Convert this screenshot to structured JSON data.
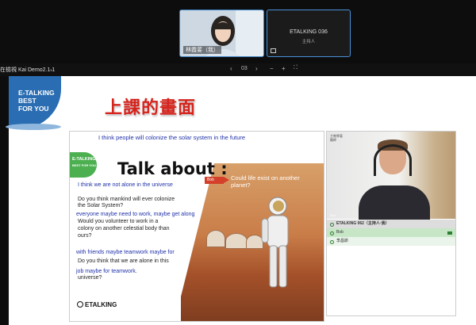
{
  "video_tiles": {
    "tile_a_name": "林霞荽（我）",
    "tile_b_title": "ETALKING 036",
    "tile_b_subtitle": "主持人"
  },
  "toolbar": {
    "document_name": "在檢視 Kai Demo2.1.1",
    "prev_icon": "‹",
    "page_number": "03",
    "next_icon": "›",
    "zoom_out_icon": "−",
    "zoom_in_icon": "+",
    "fullscreen_icon": "⛶"
  },
  "canvas": {
    "logo_line1": "E-TALKING",
    "logo_line2": "BEST",
    "logo_line3": "FOR YOU",
    "page_heading": "上課的畫面"
  },
  "slide": {
    "logo_line1": "E-TALKING",
    "logo_line2": "BEST FOR YOU",
    "annotation_top": "I think people will colonize the solar system in the future",
    "heading": "Talk about :",
    "arrow_tag": "Bob",
    "mars_question_l1": "Could life exist on another",
    "mars_question_l2": "planet?",
    "annotation_1": "I think we are not alone in the universe",
    "q1_l1": "Do you think mankind will ever colonize",
    "q1_l2": "the Solar System?",
    "annotation_2": "everyone maybe need to work, maybe get along",
    "q2_l1": "Would you volunteer to work in a",
    "q2_l2": "colony on another celestial body than",
    "q2_l3": "ours?",
    "annotation_3": "with friends maybe teamwork maybe for",
    "q3_l1": "Do you think that we are alone in this",
    "annotation_4": "job maybe for teamwork.",
    "q3_l2": "universe?",
    "footer_brand": "ETALKING"
  },
  "right_panel": {
    "video_label_l1": "主教學著",
    "video_label_l2": "顯師",
    "video_sublabel": "Bob",
    "rows": {
      "header": "ETALKING 062（主持人·我）",
      "row_1": "Bob",
      "row_2": "李昌斯"
    }
  },
  "colors": {
    "accent_blue": "#2a6db2",
    "title_red": "#d6231c",
    "annotation_blue": "#2032a8",
    "mic_green": "#2e7d32"
  }
}
